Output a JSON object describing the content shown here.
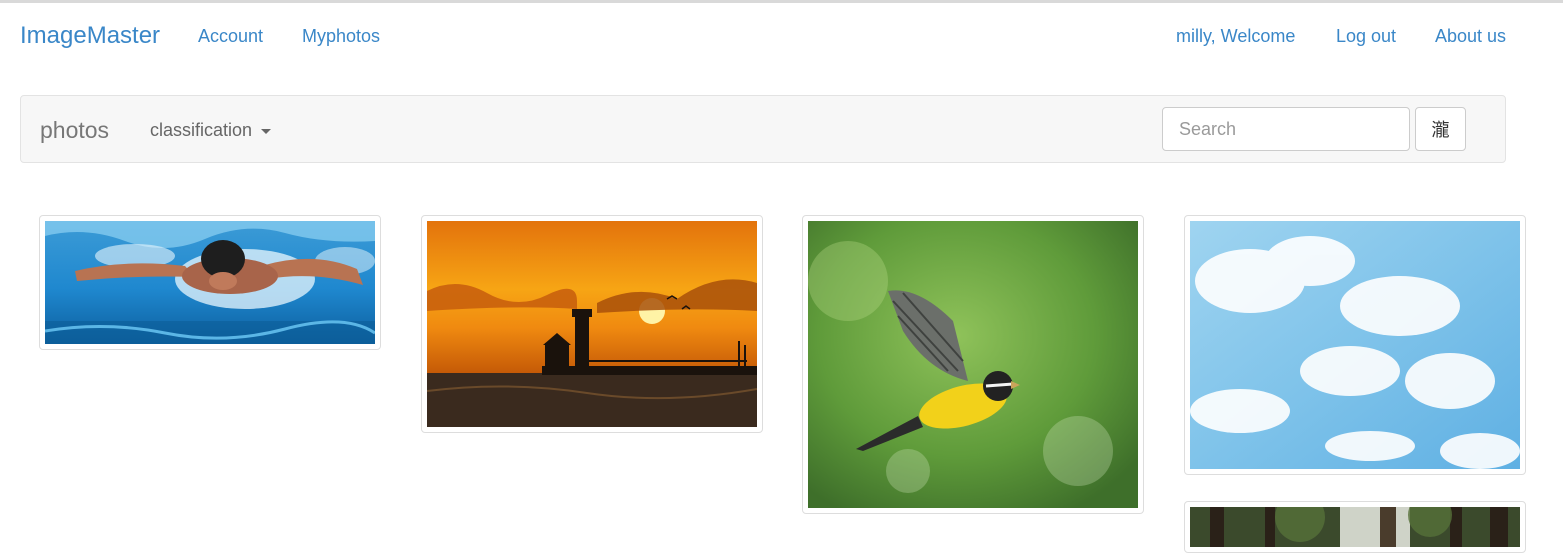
{
  "nav": {
    "brand": "ImageMaster",
    "links": [
      "Account",
      "Myphotos"
    ],
    "user_greeting": "milly, Welcome",
    "logout": "Log out",
    "about": "About us"
  },
  "toolbar": {
    "title": "photos",
    "classification_label": "classification",
    "search_placeholder": "Search",
    "search_button_glyph": "瀧"
  },
  "photos": [
    {
      "subject": "swimmer doing butterfly stroke"
    },
    {
      "subject": "lighthouse silhouette at sunset"
    },
    {
      "subject": "yellow bird in flight"
    },
    {
      "subject": "blue sky with white clouds"
    },
    {
      "subject": "trees in a park"
    }
  ],
  "colors": {
    "link": "#3a87c8",
    "bar_background": "#f7f7f7",
    "muted_text": "#777777"
  }
}
